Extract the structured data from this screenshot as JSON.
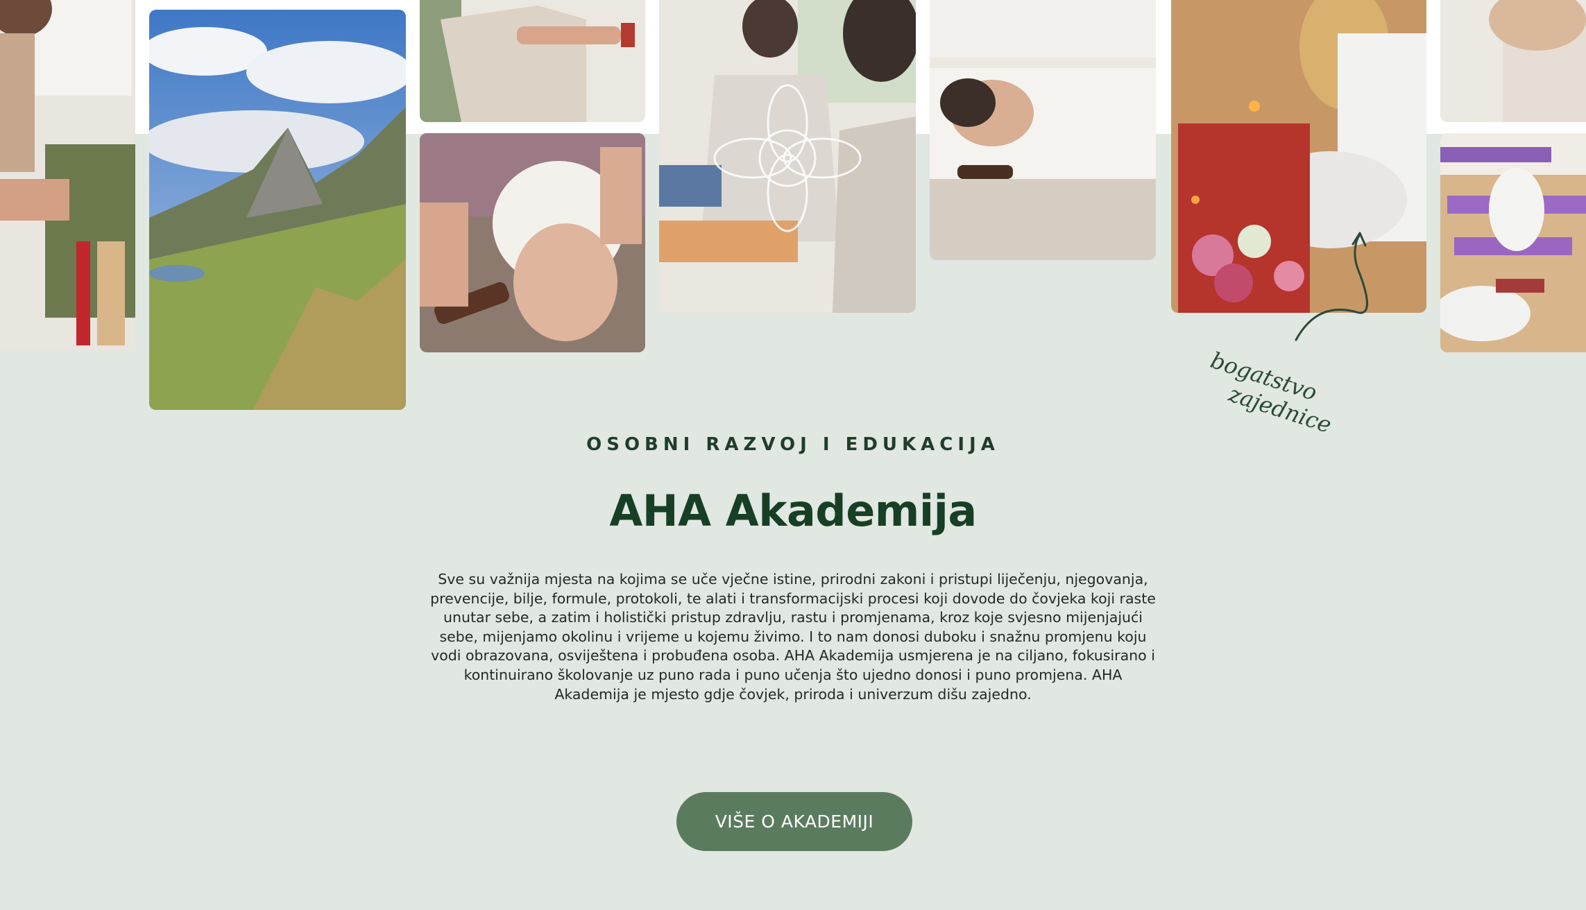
{
  "section": {
    "eyebrow": "OSOBNI RAZVOJ I EDUKACIJA",
    "title": "AHA Akademija",
    "body": "Sve su važnija mjesta na kojima se uče vječne istine, prirodni zakoni i pristupi liječenju, njegovanja, prevencije, bilje, formule, protokoli, te alati i transformacijski procesi koji dovode do čovjeka koji raste unutar sebe, a zatim i holistički pristup zdravlju, rastu i promjenama, kroz koje svjesno mijenjajući sebe, mijenjamo okolinu i vrijeme u kojemu živimo. I to nam donosi duboku i snažnu promjenu koju vodi obrazovana, osviještena i probuđena osoba. AHA Akademija usmjerena je na ciljano, fokusirano i kontinuirano školovanje uz puno rada i puno učenja što ujedno donosi i puno promjena. AHA Akademija je mjesto gdje čovjek, priroda i univerzum dišu zajedno.",
    "cta_label": "VIŠE O AKADEMIJI"
  },
  "annotation": {
    "line1": "bogatstvo",
    "line2": "zajednice",
    "icon": "curved-arrow-icon"
  },
  "gallery": {
    "photos": [
      "photo-massage-session",
      "photo-mountain-landscape",
      "photo-yoga-movement",
      "photo-face-treatment",
      "photo-meditation-group",
      "photo-relaxation-therapy",
      "photo-candle-ceremony",
      "photo-yoga-class-top",
      "photo-yoga-class"
    ]
  },
  "colors": {
    "section_bg": "#e1e7e1",
    "title": "#173f26",
    "cta_bg": "#5b7b5e"
  }
}
